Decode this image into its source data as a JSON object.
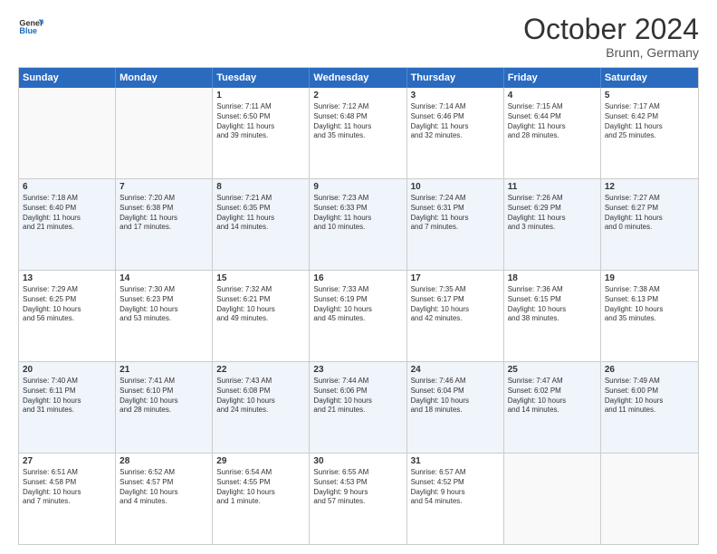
{
  "header": {
    "logo_line1": "General",
    "logo_line2": "Blue",
    "month": "October 2024",
    "location": "Brunn, Germany"
  },
  "weekdays": [
    "Sunday",
    "Monday",
    "Tuesday",
    "Wednesday",
    "Thursday",
    "Friday",
    "Saturday"
  ],
  "rows": [
    {
      "alt": false,
      "cells": [
        {
          "day": "",
          "lines": []
        },
        {
          "day": "",
          "lines": []
        },
        {
          "day": "1",
          "lines": [
            "Sunrise: 7:11 AM",
            "Sunset: 6:50 PM",
            "Daylight: 11 hours",
            "and 39 minutes."
          ]
        },
        {
          "day": "2",
          "lines": [
            "Sunrise: 7:12 AM",
            "Sunset: 6:48 PM",
            "Daylight: 11 hours",
            "and 35 minutes."
          ]
        },
        {
          "day": "3",
          "lines": [
            "Sunrise: 7:14 AM",
            "Sunset: 6:46 PM",
            "Daylight: 11 hours",
            "and 32 minutes."
          ]
        },
        {
          "day": "4",
          "lines": [
            "Sunrise: 7:15 AM",
            "Sunset: 6:44 PM",
            "Daylight: 11 hours",
            "and 28 minutes."
          ]
        },
        {
          "day": "5",
          "lines": [
            "Sunrise: 7:17 AM",
            "Sunset: 6:42 PM",
            "Daylight: 11 hours",
            "and 25 minutes."
          ]
        }
      ]
    },
    {
      "alt": true,
      "cells": [
        {
          "day": "6",
          "lines": [
            "Sunrise: 7:18 AM",
            "Sunset: 6:40 PM",
            "Daylight: 11 hours",
            "and 21 minutes."
          ]
        },
        {
          "day": "7",
          "lines": [
            "Sunrise: 7:20 AM",
            "Sunset: 6:38 PM",
            "Daylight: 11 hours",
            "and 17 minutes."
          ]
        },
        {
          "day": "8",
          "lines": [
            "Sunrise: 7:21 AM",
            "Sunset: 6:35 PM",
            "Daylight: 11 hours",
            "and 14 minutes."
          ]
        },
        {
          "day": "9",
          "lines": [
            "Sunrise: 7:23 AM",
            "Sunset: 6:33 PM",
            "Daylight: 11 hours",
            "and 10 minutes."
          ]
        },
        {
          "day": "10",
          "lines": [
            "Sunrise: 7:24 AM",
            "Sunset: 6:31 PM",
            "Daylight: 11 hours",
            "and 7 minutes."
          ]
        },
        {
          "day": "11",
          "lines": [
            "Sunrise: 7:26 AM",
            "Sunset: 6:29 PM",
            "Daylight: 11 hours",
            "and 3 minutes."
          ]
        },
        {
          "day": "12",
          "lines": [
            "Sunrise: 7:27 AM",
            "Sunset: 6:27 PM",
            "Daylight: 11 hours",
            "and 0 minutes."
          ]
        }
      ]
    },
    {
      "alt": false,
      "cells": [
        {
          "day": "13",
          "lines": [
            "Sunrise: 7:29 AM",
            "Sunset: 6:25 PM",
            "Daylight: 10 hours",
            "and 56 minutes."
          ]
        },
        {
          "day": "14",
          "lines": [
            "Sunrise: 7:30 AM",
            "Sunset: 6:23 PM",
            "Daylight: 10 hours",
            "and 53 minutes."
          ]
        },
        {
          "day": "15",
          "lines": [
            "Sunrise: 7:32 AM",
            "Sunset: 6:21 PM",
            "Daylight: 10 hours",
            "and 49 minutes."
          ]
        },
        {
          "day": "16",
          "lines": [
            "Sunrise: 7:33 AM",
            "Sunset: 6:19 PM",
            "Daylight: 10 hours",
            "and 45 minutes."
          ]
        },
        {
          "day": "17",
          "lines": [
            "Sunrise: 7:35 AM",
            "Sunset: 6:17 PM",
            "Daylight: 10 hours",
            "and 42 minutes."
          ]
        },
        {
          "day": "18",
          "lines": [
            "Sunrise: 7:36 AM",
            "Sunset: 6:15 PM",
            "Daylight: 10 hours",
            "and 38 minutes."
          ]
        },
        {
          "day": "19",
          "lines": [
            "Sunrise: 7:38 AM",
            "Sunset: 6:13 PM",
            "Daylight: 10 hours",
            "and 35 minutes."
          ]
        }
      ]
    },
    {
      "alt": true,
      "cells": [
        {
          "day": "20",
          "lines": [
            "Sunrise: 7:40 AM",
            "Sunset: 6:11 PM",
            "Daylight: 10 hours",
            "and 31 minutes."
          ]
        },
        {
          "day": "21",
          "lines": [
            "Sunrise: 7:41 AM",
            "Sunset: 6:10 PM",
            "Daylight: 10 hours",
            "and 28 minutes."
          ]
        },
        {
          "day": "22",
          "lines": [
            "Sunrise: 7:43 AM",
            "Sunset: 6:08 PM",
            "Daylight: 10 hours",
            "and 24 minutes."
          ]
        },
        {
          "day": "23",
          "lines": [
            "Sunrise: 7:44 AM",
            "Sunset: 6:06 PM",
            "Daylight: 10 hours",
            "and 21 minutes."
          ]
        },
        {
          "day": "24",
          "lines": [
            "Sunrise: 7:46 AM",
            "Sunset: 6:04 PM",
            "Daylight: 10 hours",
            "and 18 minutes."
          ]
        },
        {
          "day": "25",
          "lines": [
            "Sunrise: 7:47 AM",
            "Sunset: 6:02 PM",
            "Daylight: 10 hours",
            "and 14 minutes."
          ]
        },
        {
          "day": "26",
          "lines": [
            "Sunrise: 7:49 AM",
            "Sunset: 6:00 PM",
            "Daylight: 10 hours",
            "and 11 minutes."
          ]
        }
      ]
    },
    {
      "alt": false,
      "cells": [
        {
          "day": "27",
          "lines": [
            "Sunrise: 6:51 AM",
            "Sunset: 4:58 PM",
            "Daylight: 10 hours",
            "and 7 minutes."
          ]
        },
        {
          "day": "28",
          "lines": [
            "Sunrise: 6:52 AM",
            "Sunset: 4:57 PM",
            "Daylight: 10 hours",
            "and 4 minutes."
          ]
        },
        {
          "day": "29",
          "lines": [
            "Sunrise: 6:54 AM",
            "Sunset: 4:55 PM",
            "Daylight: 10 hours",
            "and 1 minute."
          ]
        },
        {
          "day": "30",
          "lines": [
            "Sunrise: 6:55 AM",
            "Sunset: 4:53 PM",
            "Daylight: 9 hours",
            "and 57 minutes."
          ]
        },
        {
          "day": "31",
          "lines": [
            "Sunrise: 6:57 AM",
            "Sunset: 4:52 PM",
            "Daylight: 9 hours",
            "and 54 minutes."
          ]
        },
        {
          "day": "",
          "lines": []
        },
        {
          "day": "",
          "lines": []
        }
      ]
    }
  ]
}
